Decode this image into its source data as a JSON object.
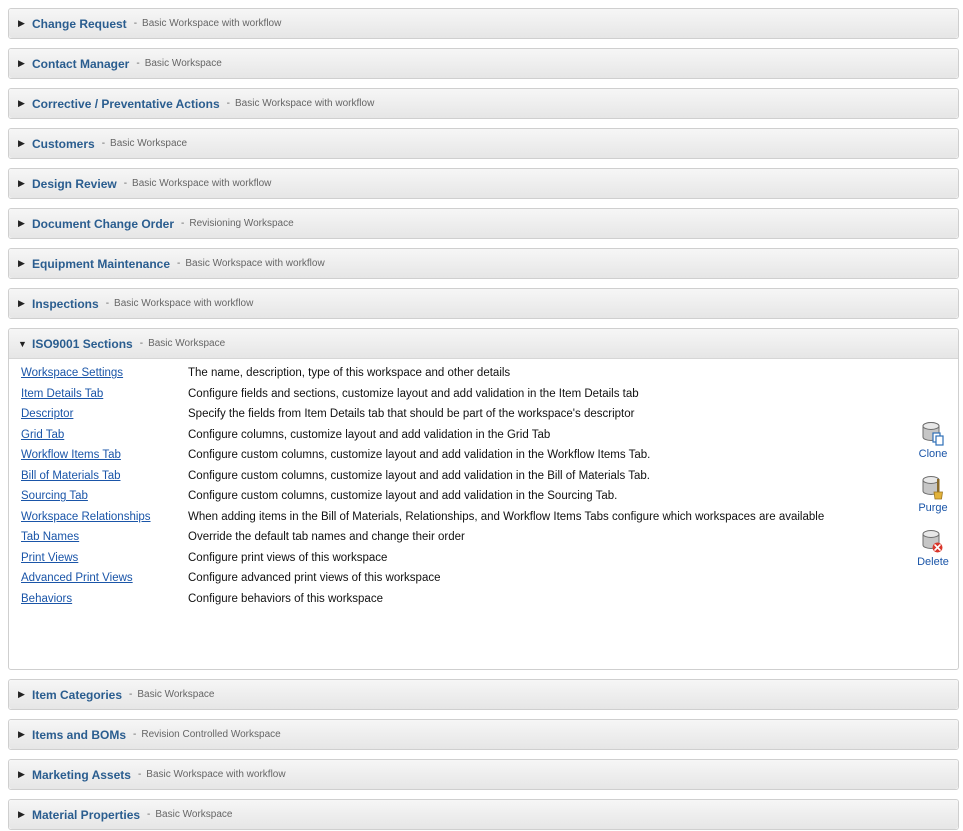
{
  "workspaces_before": [
    {
      "name": "Change Request",
      "type": "Basic Workspace with workflow"
    },
    {
      "name": "Contact Manager",
      "type": "Basic Workspace"
    },
    {
      "name": "Corrective / Preventative Actions",
      "type": "Basic Workspace with workflow"
    },
    {
      "name": "Customers",
      "type": "Basic Workspace"
    },
    {
      "name": "Design Review",
      "type": "Basic Workspace with workflow"
    },
    {
      "name": "Document Change Order",
      "type": "Revisioning Workspace"
    },
    {
      "name": "Equipment Maintenance",
      "type": "Basic Workspace with workflow"
    },
    {
      "name": "Inspections",
      "type": "Basic Workspace with workflow"
    }
  ],
  "expanded_workspace": {
    "name": "ISO9001 Sections",
    "type": "Basic Workspace",
    "settings": [
      {
        "link": "Workspace Settings",
        "desc": "The name, description, type of this workspace and other details"
      },
      {
        "link": "Item Details Tab",
        "desc": "Configure fields and sections, customize layout and add validation in the Item Details tab"
      },
      {
        "link": "Descriptor",
        "desc": "Specify the fields from Item Details tab that should be part of the workspace's descriptor"
      },
      {
        "link": "Grid Tab",
        "desc": "Configure columns, customize layout and add validation in the Grid Tab"
      },
      {
        "link": "Workflow Items Tab",
        "desc": "Configure custom columns, customize layout and add validation in the Workflow Items Tab."
      },
      {
        "link": "Bill of Materials Tab",
        "desc": "Configure custom columns, customize layout and add validation in the Bill of Materials Tab."
      },
      {
        "link": "Sourcing Tab",
        "desc": "Configure custom columns, customize layout and add validation in the Sourcing Tab."
      },
      {
        "link": "Workspace Relationships",
        "desc": "When adding items in the Bill of Materials, Relationships, and Workflow Items Tabs configure which workspaces are available"
      },
      {
        "link": "Tab Names",
        "desc": "Override the default tab names and change their order"
      },
      {
        "link": "Print Views",
        "desc": "Configure print views of this workspace"
      },
      {
        "link": "Advanced Print Views",
        "desc": "Configure advanced print views of this workspace"
      },
      {
        "link": "Behaviors",
        "desc": "Configure behaviors of this workspace"
      }
    ],
    "actions": {
      "clone": "Clone",
      "purge": "Purge",
      "delete": "Delete"
    }
  },
  "workspaces_after": [
    {
      "name": "Item Categories",
      "type": "Basic Workspace"
    },
    {
      "name": "Items and BOMs",
      "type": "Revision Controlled Workspace"
    },
    {
      "name": "Marketing Assets",
      "type": "Basic Workspace with workflow"
    },
    {
      "name": "Material Properties",
      "type": "Basic Workspace"
    }
  ],
  "separator": "-",
  "colors": {
    "link": "#1a55a8",
    "workspace_name": "#2a5d8f",
    "header_bg": "#ececec",
    "border": "#cfcfcf"
  },
  "icons": {
    "collapsed": "triangle-right-icon",
    "expanded": "triangle-down-icon",
    "clone": "database-clone-icon",
    "purge": "database-purge-icon",
    "delete": "database-delete-icon"
  }
}
